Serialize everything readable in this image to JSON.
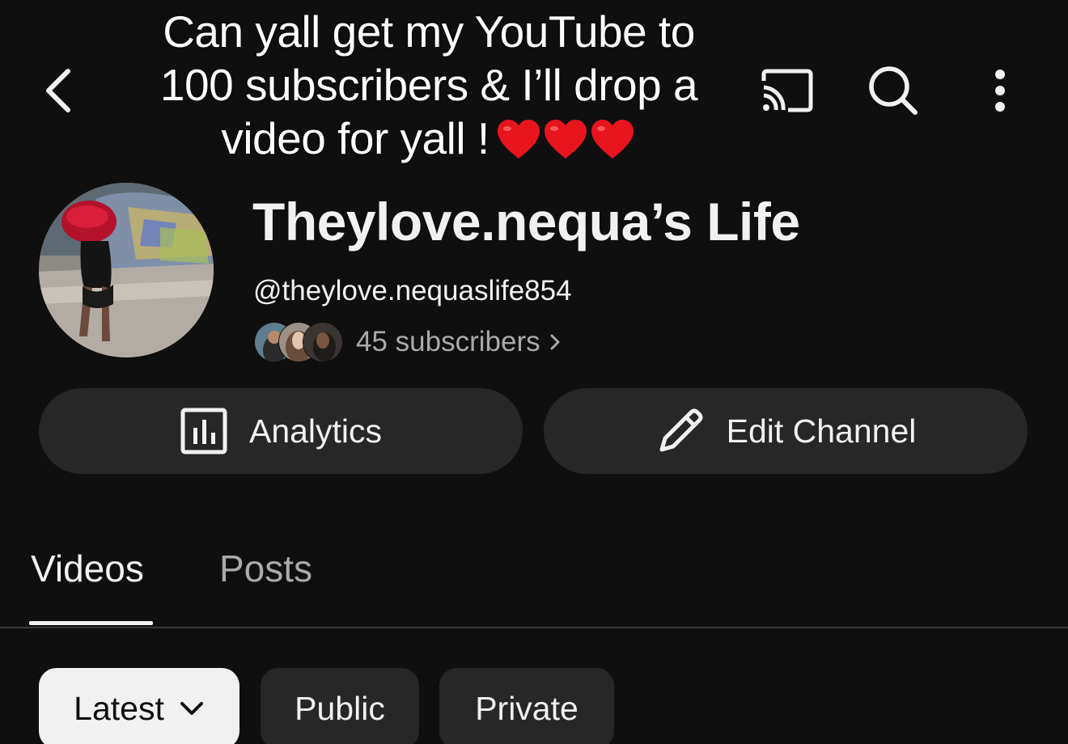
{
  "overlay_caption": {
    "line1": "Can yall get my YouTube to",
    "line2": "100 subscribers & I’ll drop a",
    "line3": "video for yall !",
    "emoji": "heart-emoji x3",
    "heart_color": "#e8141e"
  },
  "topbar": {
    "back_icon": "chevron-left-icon",
    "actions": [
      "cast-icon",
      "search-icon",
      "more-vert-icon"
    ]
  },
  "channel": {
    "name": "Theylove.nequa’s Life",
    "handle": "@theylove.nequaslife854",
    "subscribers": "45 subscribers"
  },
  "actions": {
    "analytics_label": "Analytics",
    "edit_label": "Edit Channel"
  },
  "tabs": [
    {
      "label": "Videos",
      "active": true
    },
    {
      "label": "Posts",
      "active": false
    }
  ],
  "filters": {
    "sort_label": "Latest",
    "chips": [
      "Public",
      "Private"
    ]
  },
  "colors": {
    "background": "#0f0f0f",
    "surface": "#272727",
    "text_primary": "#f1f1f1",
    "text_secondary": "#aaaaaa"
  }
}
